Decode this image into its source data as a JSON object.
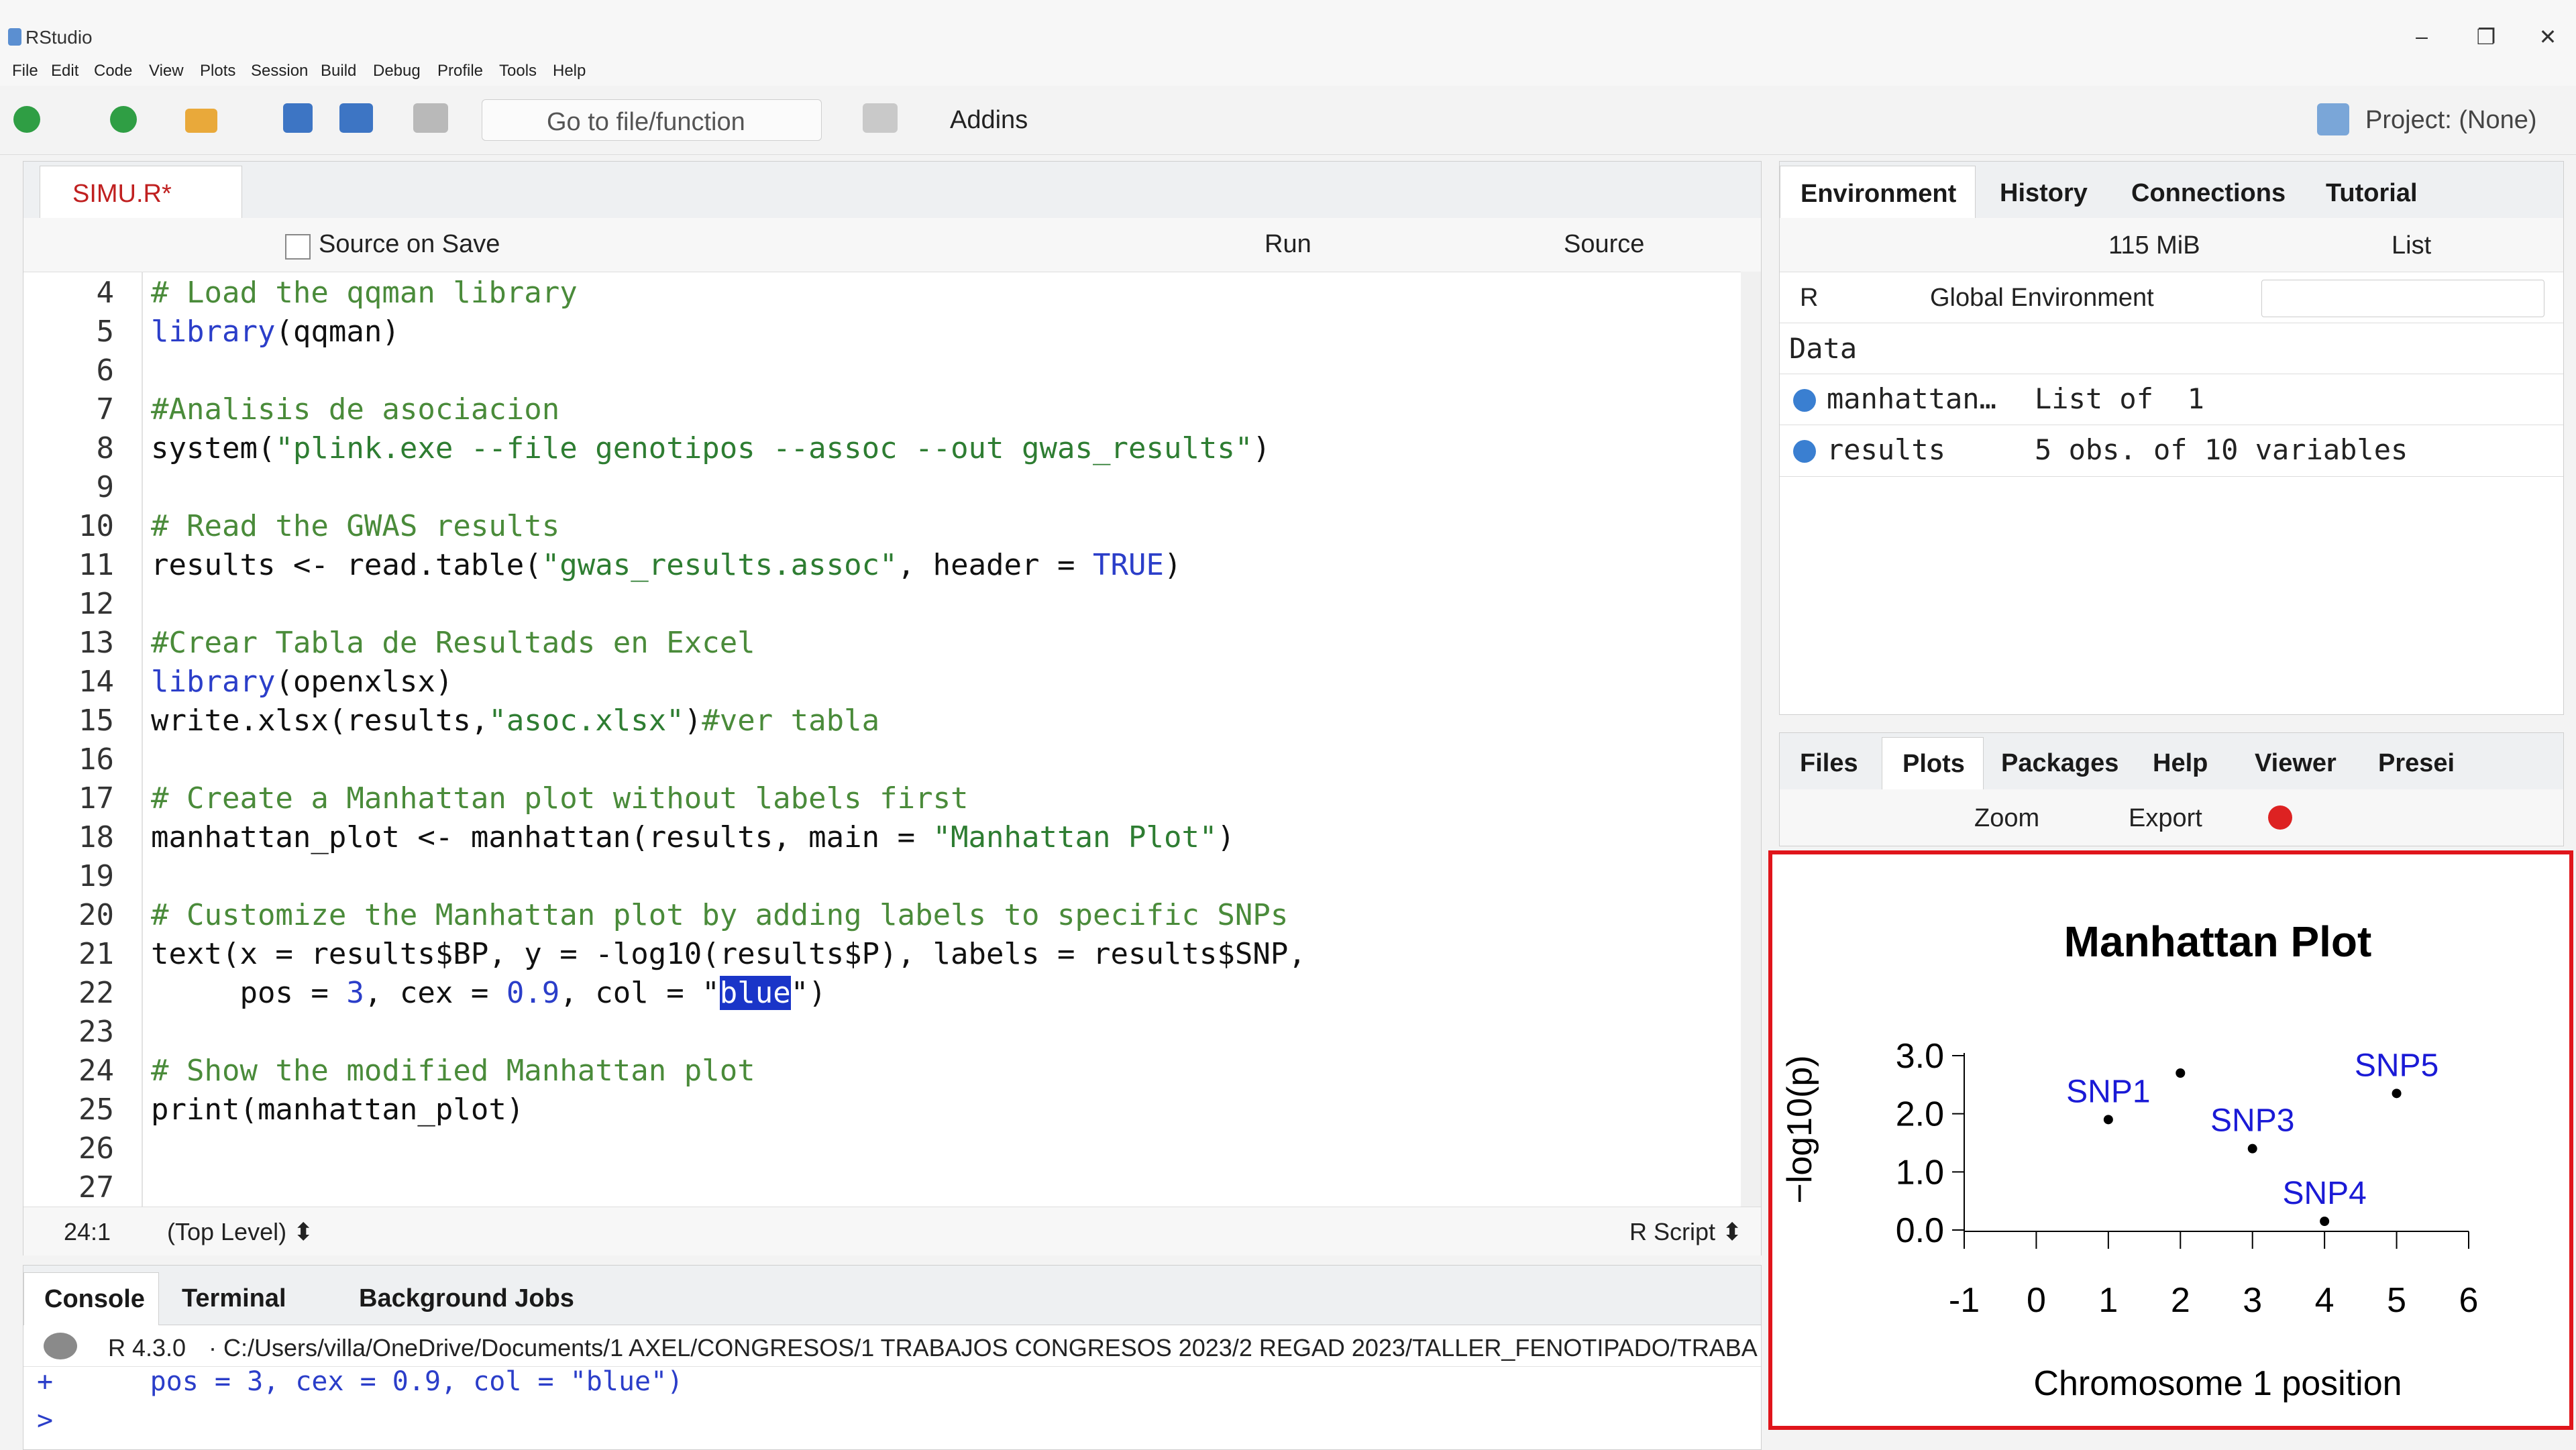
{
  "window": {
    "title": "RStudio",
    "controls": [
      "–",
      "❐",
      "✕"
    ]
  },
  "menu": [
    "File",
    "Edit",
    "Code",
    "View",
    "Plots",
    "Session",
    "Build",
    "Debug",
    "Profile",
    "Tools",
    "Help"
  ],
  "toolbar": {
    "goto_placeholder": "Go to file/function",
    "addins": "Addins",
    "project": "Project: (None)"
  },
  "editor": {
    "tab_label": "SIMU.R*",
    "source_on_save": "Source on Save",
    "run": "Run",
    "source": "Source",
    "lines": [
      {
        "n": "4",
        "segs": [
          [
            "c",
            "# Load the qqman library"
          ]
        ]
      },
      {
        "n": "5",
        "segs": [
          [
            "k",
            "library"
          ],
          [
            "p",
            "(qqman)"
          ]
        ]
      },
      {
        "n": "6",
        "segs": []
      },
      {
        "n": "7",
        "segs": [
          [
            "c",
            "#Analisis de asociacion"
          ]
        ]
      },
      {
        "n": "8",
        "segs": [
          [
            "p",
            "system("
          ],
          [
            "s",
            "\"plink.exe --file genotipos --assoc --out gwas_results\""
          ],
          [
            "p",
            ")"
          ]
        ]
      },
      {
        "n": "9",
        "segs": []
      },
      {
        "n": "10",
        "segs": [
          [
            "c",
            "# Read the GWAS results"
          ]
        ]
      },
      {
        "n": "11",
        "segs": [
          [
            "p",
            "results <- read.table("
          ],
          [
            "s",
            "\"gwas_results.assoc\""
          ],
          [
            "p",
            ", header = "
          ],
          [
            "k",
            "TRUE"
          ],
          [
            "p",
            ")"
          ]
        ]
      },
      {
        "n": "12",
        "segs": []
      },
      {
        "n": "13",
        "segs": [
          [
            "c",
            "#Crear Tabla de Resultads en Excel"
          ]
        ]
      },
      {
        "n": "14",
        "segs": [
          [
            "k",
            "library"
          ],
          [
            "p",
            "(openxlsx)"
          ]
        ]
      },
      {
        "n": "15",
        "segs": [
          [
            "p",
            "write.xlsx(results,"
          ],
          [
            "s",
            "\"asoc.xlsx\""
          ],
          [
            "p",
            ")"
          ],
          [
            "c",
            "#ver tabla"
          ]
        ]
      },
      {
        "n": "16",
        "segs": []
      },
      {
        "n": "17",
        "segs": [
          [
            "c",
            "# Create a Manhattan plot without labels first"
          ]
        ]
      },
      {
        "n": "18",
        "segs": [
          [
            "p",
            "manhattan_plot <- manhattan(results, main = "
          ],
          [
            "s",
            "\"Manhattan Plot\""
          ],
          [
            "p",
            ")"
          ]
        ]
      },
      {
        "n": "19",
        "segs": []
      },
      {
        "n": "20",
        "segs": [
          [
            "c",
            "# Customize the Manhattan plot by adding labels to specific SNPs"
          ]
        ]
      },
      {
        "n": "21",
        "segs": [
          [
            "p",
            "text(x = results$BP, y = -log10(results$P), labels = results$SNP,"
          ]
        ]
      },
      {
        "n": "22",
        "segs": [
          [
            "p",
            "     pos = "
          ],
          [
            "n",
            "3"
          ],
          [
            "p",
            ", cex = "
          ],
          [
            "n",
            "0.9"
          ],
          [
            "p",
            ", col = \""
          ],
          [
            "sel",
            "blue"
          ],
          [
            "p",
            "\")"
          ]
        ]
      },
      {
        "n": "23",
        "segs": []
      },
      {
        "n": "24",
        "segs": [
          [
            "c",
            "# Show the modified Manhattan plot"
          ]
        ]
      },
      {
        "n": "25",
        "segs": [
          [
            "p",
            "print(manhattan_plot)"
          ]
        ]
      },
      {
        "n": "26",
        "segs": []
      },
      {
        "n": "27",
        "segs": []
      }
    ],
    "status_pos": "24:1",
    "status_scope": "(Top Level) ⬍",
    "status_type": "R Script ⬍"
  },
  "console": {
    "tabs": [
      "Console",
      "Terminal",
      "Background Jobs"
    ],
    "r_version": "R 4.3.0",
    "path": "·  C:/Users/villa/OneDrive/Documents/1 AXEL/CONGRESOS/1 TRABAJOS CONGRESOS 2023/2 REGAD 2023/TALLER_FENOTIPADO/TRABA",
    "continuation": "+      pos = 3, cex = 0.9, col = \"blue\")",
    "prompt": ">"
  },
  "environment": {
    "tabs": [
      "Environment",
      "History",
      "Connections",
      "Tutorial"
    ],
    "memory": "115 MiB",
    "view_mode": "List",
    "lang": "R",
    "scope": "Global Environment",
    "section": "Data",
    "rows": [
      {
        "name": "manhattan…",
        "value": "List of  1"
      },
      {
        "name": "results",
        "value": "5 obs. of 10 variables"
      }
    ]
  },
  "files_pane": {
    "tabs": [
      "Files",
      "Plots",
      "Packages",
      "Help",
      "Viewer",
      "Presei"
    ],
    "zoom": "Zoom",
    "export": "Export"
  },
  "chart_data": {
    "type": "scatter",
    "title": "Manhattan Plot",
    "xlabel": "Chromosome 1 position",
    "ylabel": "−log10(p)",
    "xlim": [
      -1,
      6
    ],
    "ylim": [
      0,
      3.0
    ],
    "xticks": [
      "-1",
      "0",
      "1",
      "2",
      "3",
      "4",
      "5",
      "6"
    ],
    "yticks": [
      "0.0",
      "1.0",
      "2.0",
      "3.0"
    ],
    "points": [
      {
        "x": 1,
        "y": 1.9
      },
      {
        "x": 2,
        "y": 2.7
      },
      {
        "x": 3,
        "y": 1.4
      },
      {
        "x": 4,
        "y": 0.15
      },
      {
        "x": 5,
        "y": 2.35
      }
    ],
    "labels": [
      {
        "text": "SNP1",
        "x": 1,
        "y": 1.9
      },
      {
        "text": "SNP3",
        "x": 3,
        "y": 1.4
      },
      {
        "text": "SNP4",
        "x": 4,
        "y": 0.15
      },
      {
        "text": "SNP5",
        "x": 5,
        "y": 2.35
      }
    ],
    "label_color": "#1a1ad6",
    "highlight_border": "#e0151b"
  }
}
